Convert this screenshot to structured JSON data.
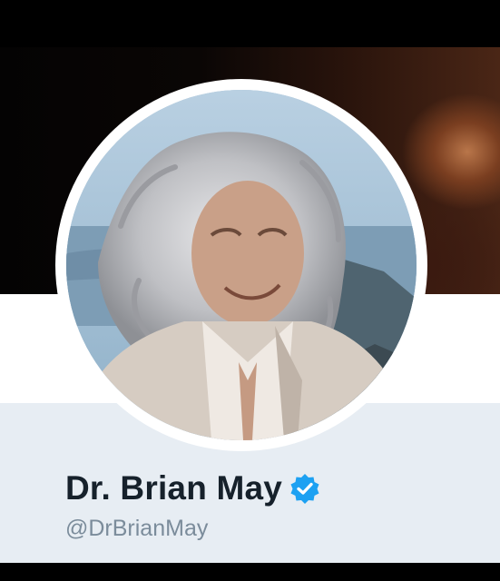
{
  "profile": {
    "display_name": "Dr. Brian May",
    "handle": "@DrBrianMay",
    "verified": true,
    "avatar_icon": "profile-photo",
    "verified_icon": "verified-badge-icon"
  },
  "colors": {
    "verified_blue": "#1da1f2",
    "name_text": "#16212b",
    "handle_text": "#7b8c9b",
    "panel_background": "#e7edf3"
  }
}
